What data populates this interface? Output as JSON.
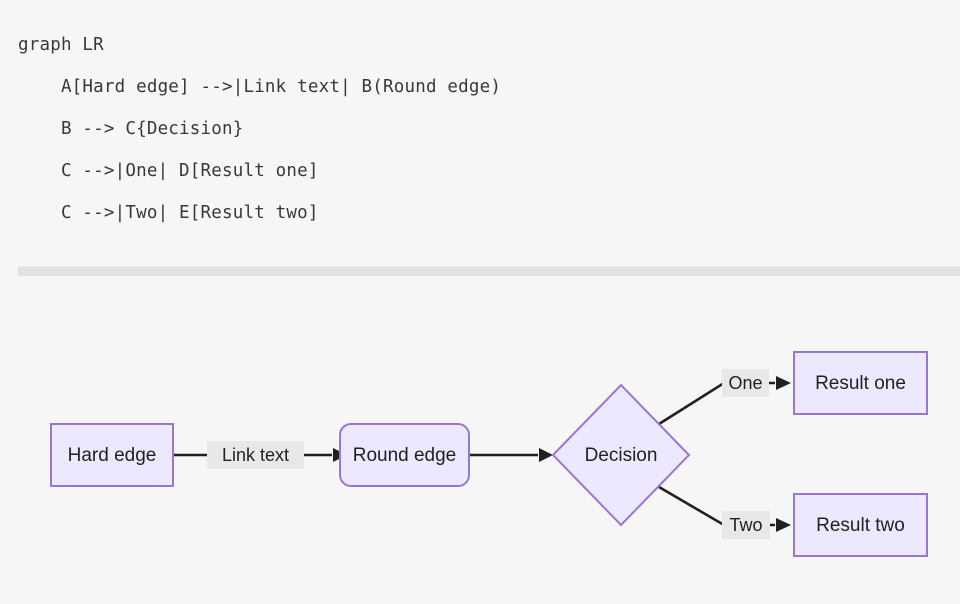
{
  "theme": {
    "page_background": "#f6f6f6",
    "node_fill": "#ece8fd",
    "node_border": "#9a76d1",
    "edge_color": "#1f2020",
    "edge_label_background": "#e8e8e8",
    "code_text_color": "#36393b",
    "divider_color": "#e2e2e2"
  },
  "code": {
    "lines": [
      "graph LR",
      "    A[Hard edge] -->|Link text| B(Round edge)",
      "    B --> C{Decision}",
      "    C -->|One| D[Result one]",
      "    C -->|Two| E[Result two]"
    ]
  },
  "diagram": {
    "direction": "LR",
    "nodes": [
      {
        "id": "A",
        "label": "Hard edge",
        "shape": "rect"
      },
      {
        "id": "B",
        "label": "Round edge",
        "shape": "round-rect"
      },
      {
        "id": "C",
        "label": "Decision",
        "shape": "diamond"
      },
      {
        "id": "D",
        "label": "Result one",
        "shape": "rect"
      },
      {
        "id": "E",
        "label": "Result two",
        "shape": "rect"
      }
    ],
    "edges": [
      {
        "from": "A",
        "to": "B",
        "label": "Link text"
      },
      {
        "from": "B",
        "to": "C",
        "label": ""
      },
      {
        "from": "C",
        "to": "D",
        "label": "One"
      },
      {
        "from": "C",
        "to": "E",
        "label": "Two"
      }
    ]
  }
}
